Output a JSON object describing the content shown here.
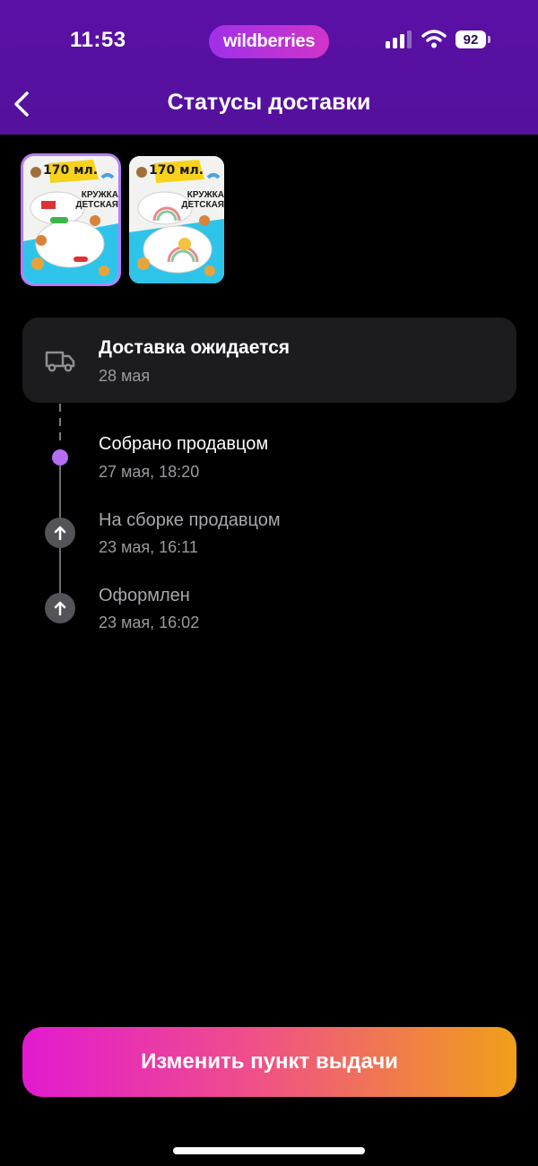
{
  "status_bar": {
    "time": "11:53",
    "brand": "wildberries",
    "battery": "92",
    "icons": [
      "signal-icon",
      "wifi-icon",
      "battery-icon"
    ]
  },
  "header": {
    "title": "Статусы доставки",
    "back_icon": "chevron-left-icon"
  },
  "products": [
    {
      "size_label": "170 мл.",
      "name": "КРУЖКА ДЕТСКАЯ",
      "selected": true
    },
    {
      "size_label": "170 мл.",
      "name": "КРУЖКА ДЕТСКАЯ",
      "selected": false
    }
  ],
  "delivery": {
    "icon": "truck-icon",
    "title": "Доставка ожидается",
    "date": "28 мая"
  },
  "timeline": [
    {
      "title": "Собрано продавцом",
      "date": "27 мая, 18:20",
      "state": "current"
    },
    {
      "title": "На сборке продавцом",
      "date": "23 мая, 16:11",
      "state": "done"
    },
    {
      "title": "Оформлен",
      "date": "23 мая, 16:02",
      "state": "done"
    }
  ],
  "actions": {
    "change_pickup_label": "Изменить пункт выдачи"
  },
  "colors": {
    "header_bg": "#5b10a6",
    "accent": "#b36ef2",
    "button_gradient": [
      "#e21ad0",
      "#ef4d8c",
      "#f0a019"
    ]
  }
}
